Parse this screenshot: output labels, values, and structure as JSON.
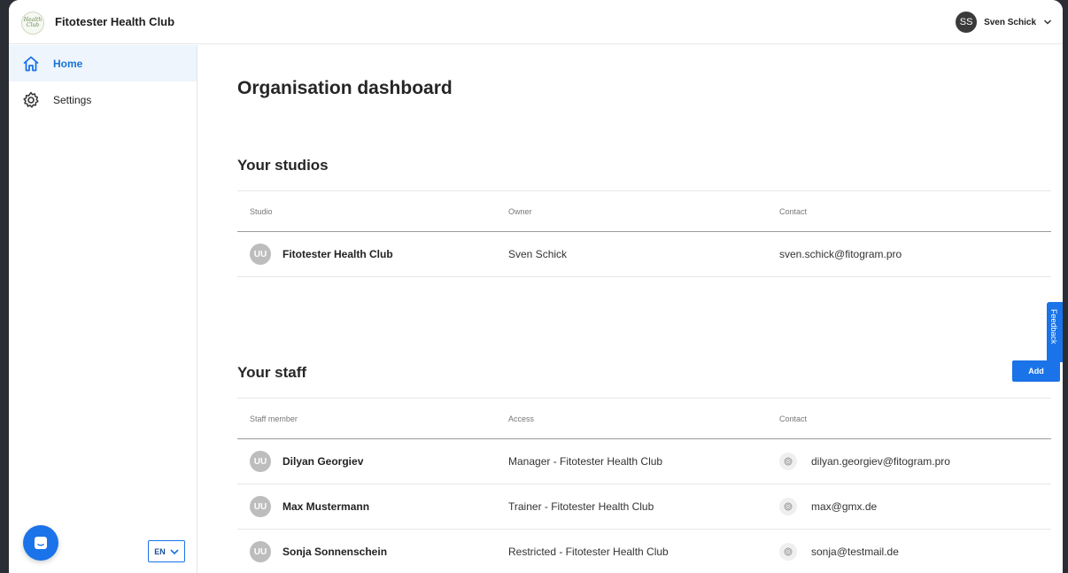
{
  "header": {
    "logo_text": "Health Club",
    "brand": "Fitotester Health Club",
    "user_initials": "SS",
    "user_name": "Sven Schick"
  },
  "sidebar": {
    "items": [
      {
        "label": "Home",
        "icon": "home-icon",
        "active": true
      },
      {
        "label": "Settings",
        "icon": "gear-icon",
        "active": false
      }
    ],
    "language": "EN"
  },
  "main": {
    "title": "Organisation dashboard",
    "studios": {
      "title": "Your studios",
      "columns": [
        "Studio",
        "Owner",
        "Contact"
      ],
      "rows": [
        {
          "initials": "UU",
          "name": "Fitotester Health Club",
          "owner": "Sven Schick",
          "contact": "sven.schick@fitogram.pro"
        }
      ]
    },
    "staff": {
      "title": "Your staff",
      "add_label": "Add",
      "columns": [
        "Staff member",
        "Access",
        "Contact"
      ],
      "rows": [
        {
          "initials": "UU",
          "name": "Dilyan Georgiev",
          "access": "Manager - Fitotester Health Club",
          "contact": "dilyan.georgiev@fitogram.pro"
        },
        {
          "initials": "UU",
          "name": "Max Mustermann",
          "access": "Trainer - Fitotester Health Club",
          "contact": "max@gmx.de"
        },
        {
          "initials": "UU",
          "name": "Sonja Sonnenschein",
          "access": "Restricted - Fitotester Health Club",
          "contact": "sonja@testmail.de"
        }
      ]
    },
    "feedback_label": "Feedback"
  },
  "colors": {
    "accent": "#1a73e8",
    "active_bg": "#eef5fc",
    "avatar_gray": "#bdbdbd"
  }
}
